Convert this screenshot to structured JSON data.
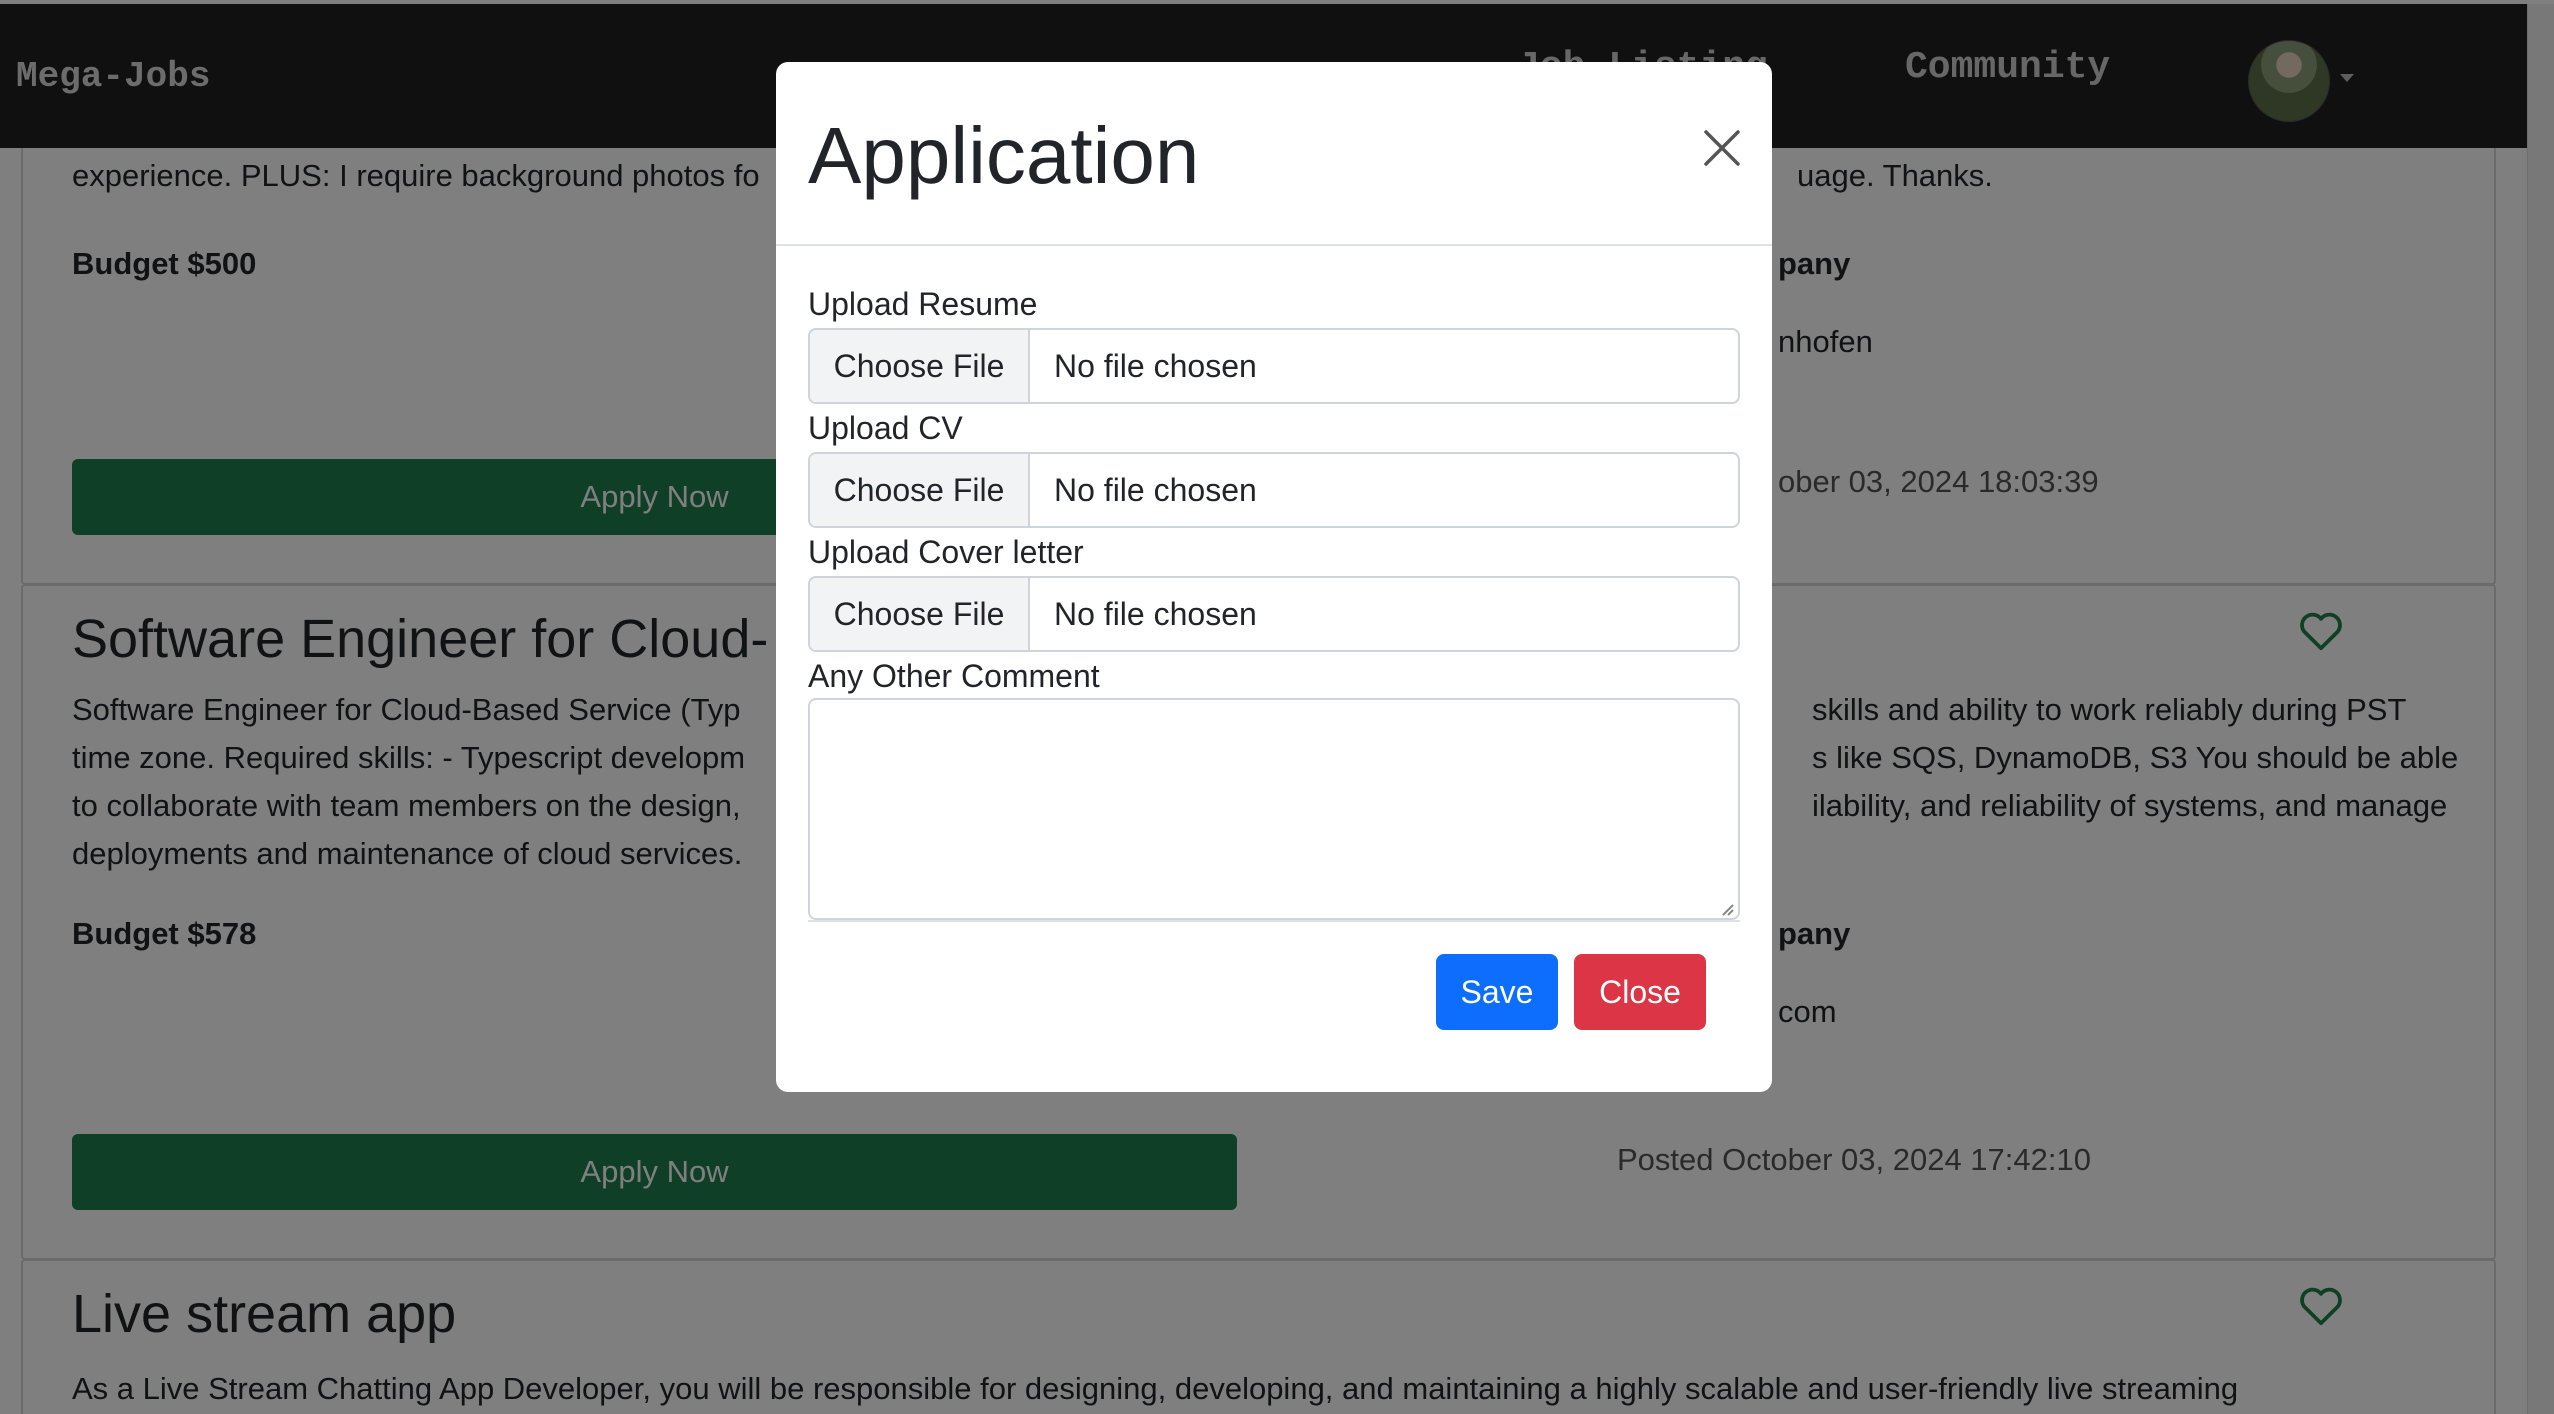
{
  "navbar": {
    "brand": "Mega-Jobs",
    "links": [
      "Job Listing",
      "Community"
    ]
  },
  "jobs": [
    {
      "description_tail": "experience. PLUS: I require background photos fo",
      "description_tail_right": "uage. Thanks.",
      "budget": "Budget $500",
      "company_label": "pany",
      "company_name": "nhofen",
      "apply_label": "Apply Now",
      "posted": "ober 03, 2024 18:03:39"
    },
    {
      "title": "Software Engineer for Cloud-",
      "description_lines_left": [
        "Software Engineer for Cloud-Based Service (Typ",
        "time zone. Required skills: - Typescript developm",
        "to collaborate with team members on the design,",
        "deployments and maintenance of cloud services."
      ],
      "description_lines_right": [
        "skills and ability to work reliably during PST",
        "s like SQS, DynamoDB, S3 You should be able",
        "ilability, and reliability of systems, and manage",
        ""
      ],
      "budget": "Budget $578",
      "company_label": "pany",
      "company_name": "com",
      "apply_label": "Apply Now",
      "posted": "Posted October 03, 2024 17:42:10"
    },
    {
      "title": "Live stream app",
      "description": "As a Live Stream Chatting App Developer, you will be responsible for designing, developing, and maintaining a highly scalable and user-friendly live streaming"
    }
  ],
  "modal": {
    "title": "Application",
    "fields": {
      "resume_label": "Upload Resume",
      "cv_label": "Upload CV",
      "cover_label": "Upload Cover letter",
      "comment_label": "Any Other Comment",
      "choose_file": "Choose File",
      "no_file": "No file chosen",
      "comment_value": ""
    },
    "save_label": "Save",
    "close_label": "Close"
  },
  "colors": {
    "navbar": "#212121",
    "apply": "#1e7e4f",
    "heart": "#1e7e4f",
    "save": "#0d6efd",
    "close": "#dc3545"
  },
  "icons": [
    "close-icon",
    "heart-icon",
    "caret-down-icon"
  ]
}
